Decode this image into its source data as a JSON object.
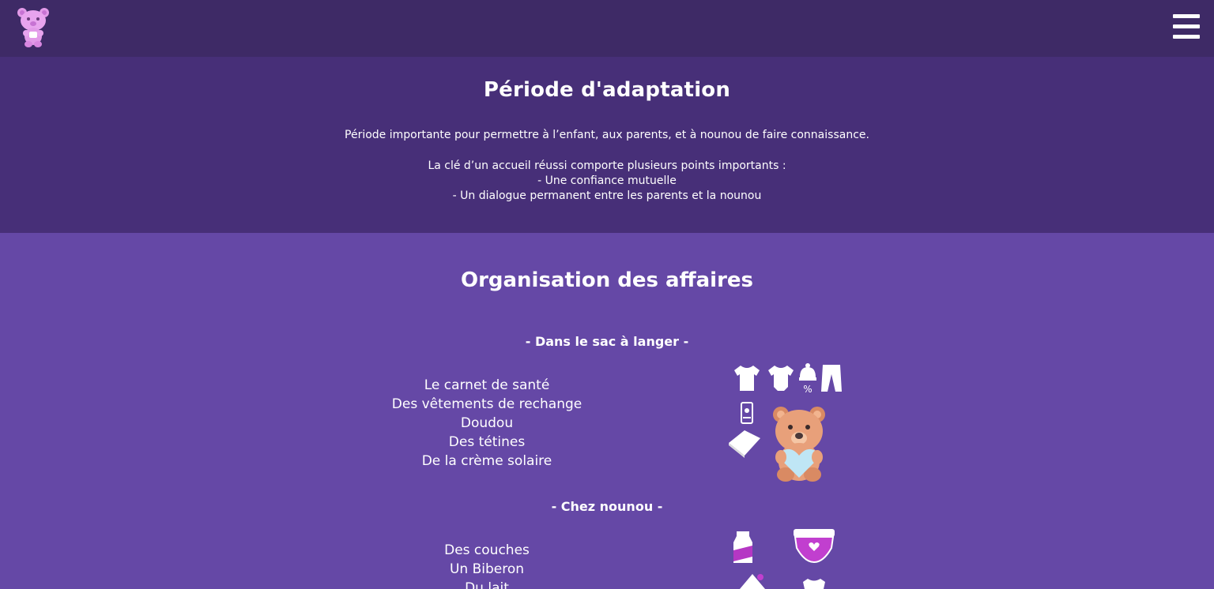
{
  "header": {
    "logo_icon": "teddy-bear-logo",
    "menu_icon": "hamburger-menu-icon"
  },
  "adaptation": {
    "title": "Période d'adaptation",
    "intro": "Période importante pour permettre à l’enfant, aux parents, et à nounou de faire connaissance.",
    "key_line": "La clé d’un accueil réussi comporte plusieurs points importants :",
    "points": [
      "- Une confiance mutuelle",
      "- Un dialogue permanent entre les parents et la nounou"
    ]
  },
  "organisation": {
    "title": "Organisation des affaires",
    "bag": {
      "heading": "- Dans le sac à langer -",
      "items": [
        "Le carnet de santé",
        "Des vêtements de rechange",
        "Doudou",
        "Des tétines",
        "De la crème solaire"
      ],
      "icons": [
        "tshirt-icon",
        "bodysuit-icon",
        "baby-hat-icon",
        "pants-icon",
        "sunscreen-icon",
        "booklet-icon",
        "teddy-bear-heart-icon"
      ]
    },
    "nanny": {
      "heading": "- Chez nounou -",
      "items": [
        "Des couches",
        "Un Biberon",
        "Du lait"
      ],
      "icons": [
        "milk-carton-icon",
        "diaper-icon",
        "baby-bottle-icon",
        "bodysuit-icon"
      ]
    }
  },
  "colors": {
    "topbar": "#3e2a66",
    "section_dark": "#472f78",
    "section_light": "#6548a6"
  }
}
